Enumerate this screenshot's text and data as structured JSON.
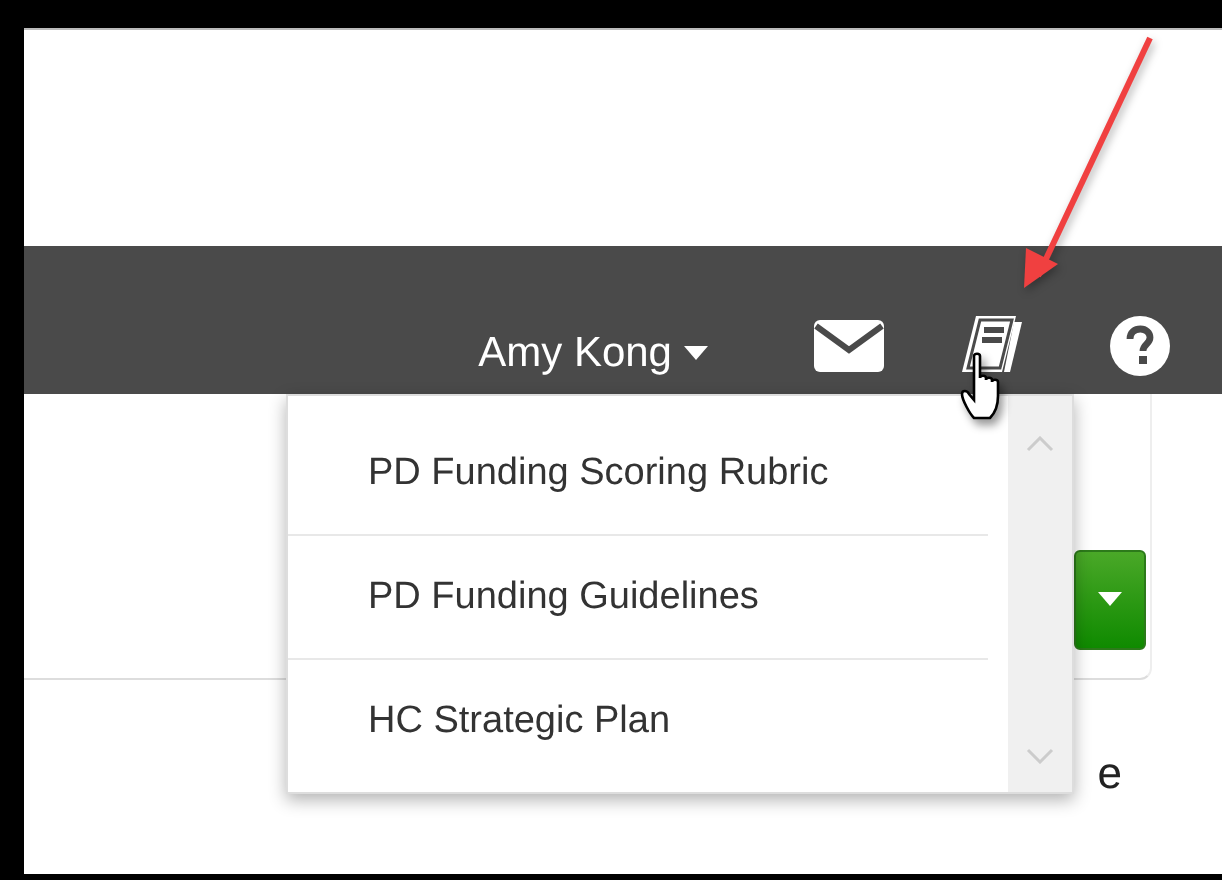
{
  "navbar": {
    "user_name": "Amy Kong"
  },
  "resources_menu": {
    "items": [
      {
        "label": "PD Funding Scoring Rubric"
      },
      {
        "label": "PD Funding Guidelines"
      },
      {
        "label": "HC Strategic Plan"
      }
    ]
  },
  "page": {
    "partial_text": "e"
  }
}
